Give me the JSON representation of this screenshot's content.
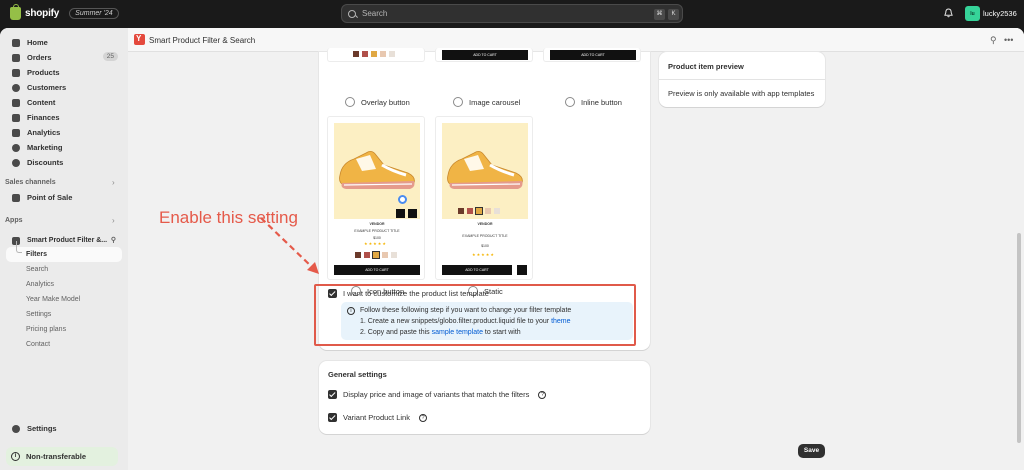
{
  "topbar": {
    "brand": "shopify",
    "edition": "Summer '24",
    "search_placeholder": "Search",
    "shortcut_keys": [
      "⌘",
      "K"
    ],
    "user_initials": "lu",
    "username": "lucky2536"
  },
  "sidebar": {
    "main_items": [
      {
        "label": "Home",
        "icon": "home-icon"
      },
      {
        "label": "Orders",
        "icon": "orders-icon",
        "badge": "25"
      },
      {
        "label": "Products",
        "icon": "tag-icon"
      },
      {
        "label": "Customers",
        "icon": "person-icon"
      },
      {
        "label": "Content",
        "icon": "content-icon"
      },
      {
        "label": "Finances",
        "icon": "bank-icon"
      },
      {
        "label": "Analytics",
        "icon": "chart-icon"
      },
      {
        "label": "Marketing",
        "icon": "target-icon"
      },
      {
        "label": "Discounts",
        "icon": "discount-icon"
      }
    ],
    "sales_channels_label": "Sales channels",
    "sales_channels": [
      {
        "label": "Point of Sale",
        "icon": "pos-icon"
      }
    ],
    "apps_label": "Apps",
    "app_name": "Smart Product Filter &...",
    "app_subitems": [
      "Filters",
      "Search",
      "Analytics",
      "Year Make Model",
      "Settings",
      "Pricing plans",
      "Contact"
    ],
    "active_subitem": "Filters",
    "settings_label": "Settings",
    "non_transferable_label": "Non-transferable"
  },
  "app_header": {
    "title": "Smart Product Filter & Search",
    "pin_icon": "pin-icon",
    "more_icon": "ellipsis-icon"
  },
  "templates": {
    "row1": [
      "Overlay button",
      "Image carousel",
      "Inline button"
    ],
    "row2": [
      "Icon button",
      "Static"
    ],
    "card_text": {
      "vendor": "VENDOR",
      "title": "EXAMPLE PRODUCT TITLE",
      "price": "$100",
      "add_to_cart": "ADD TO CART"
    },
    "swatch_colors": [
      "#6b3a2a",
      "#b0504a",
      "#e0a844",
      "#e8c8b0",
      "#e8e0d8"
    ]
  },
  "customize": {
    "checkbox_label": "I want to customize the product list template",
    "checked": true,
    "banner_line1": "Follow these following step if you want to change your filter template",
    "banner_line2_prefix": "1. Create a new snippets/globo.filter.product.liquid file to your ",
    "banner_line2_link": "theme",
    "banner_line3_prefix": "2. Copy and paste this ",
    "banner_line3_link": "sample template",
    "banner_line3_suffix": " to start with"
  },
  "general_settings": {
    "title": "General settings",
    "options": [
      {
        "label": "Display price and image of variants that match the filters",
        "checked": true,
        "help": true
      },
      {
        "label": "Variant Product Link",
        "checked": true,
        "help": true
      }
    ]
  },
  "preview_card": {
    "title": "Product item preview",
    "body": "Preview is only available with app templates"
  },
  "save_label": "Save",
  "annotation": "Enable this setting",
  "colors": {
    "accent": "#e05a4a",
    "link": "#005bd3",
    "banner_bg": "#e8f3fb",
    "shoe_bg": "#fcefc3"
  }
}
